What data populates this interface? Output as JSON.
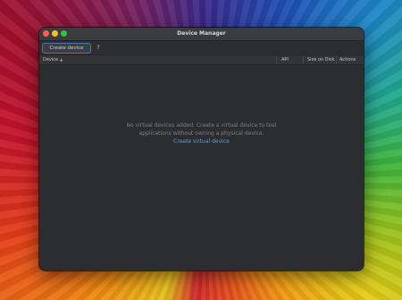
{
  "window": {
    "title": "Device Manager"
  },
  "toolbar": {
    "create_device_label": "Create device",
    "help_label": "?"
  },
  "table": {
    "columns": {
      "device": "Device",
      "sort_indicator": "▲",
      "api": "API",
      "size_on_disk": "Size on Disk",
      "actions": "Actions"
    }
  },
  "empty_state": {
    "line1": "No virtual devices added. Create a virtual device to test",
    "line2": "applications without owning a physical device.",
    "link": "Create virtual device"
  },
  "colors": {
    "window_bg": "#2b2d30",
    "accent_link": "#5f9de0",
    "close": "#ff5f57",
    "minimize": "#febc2e",
    "maximize": "#28c840"
  }
}
